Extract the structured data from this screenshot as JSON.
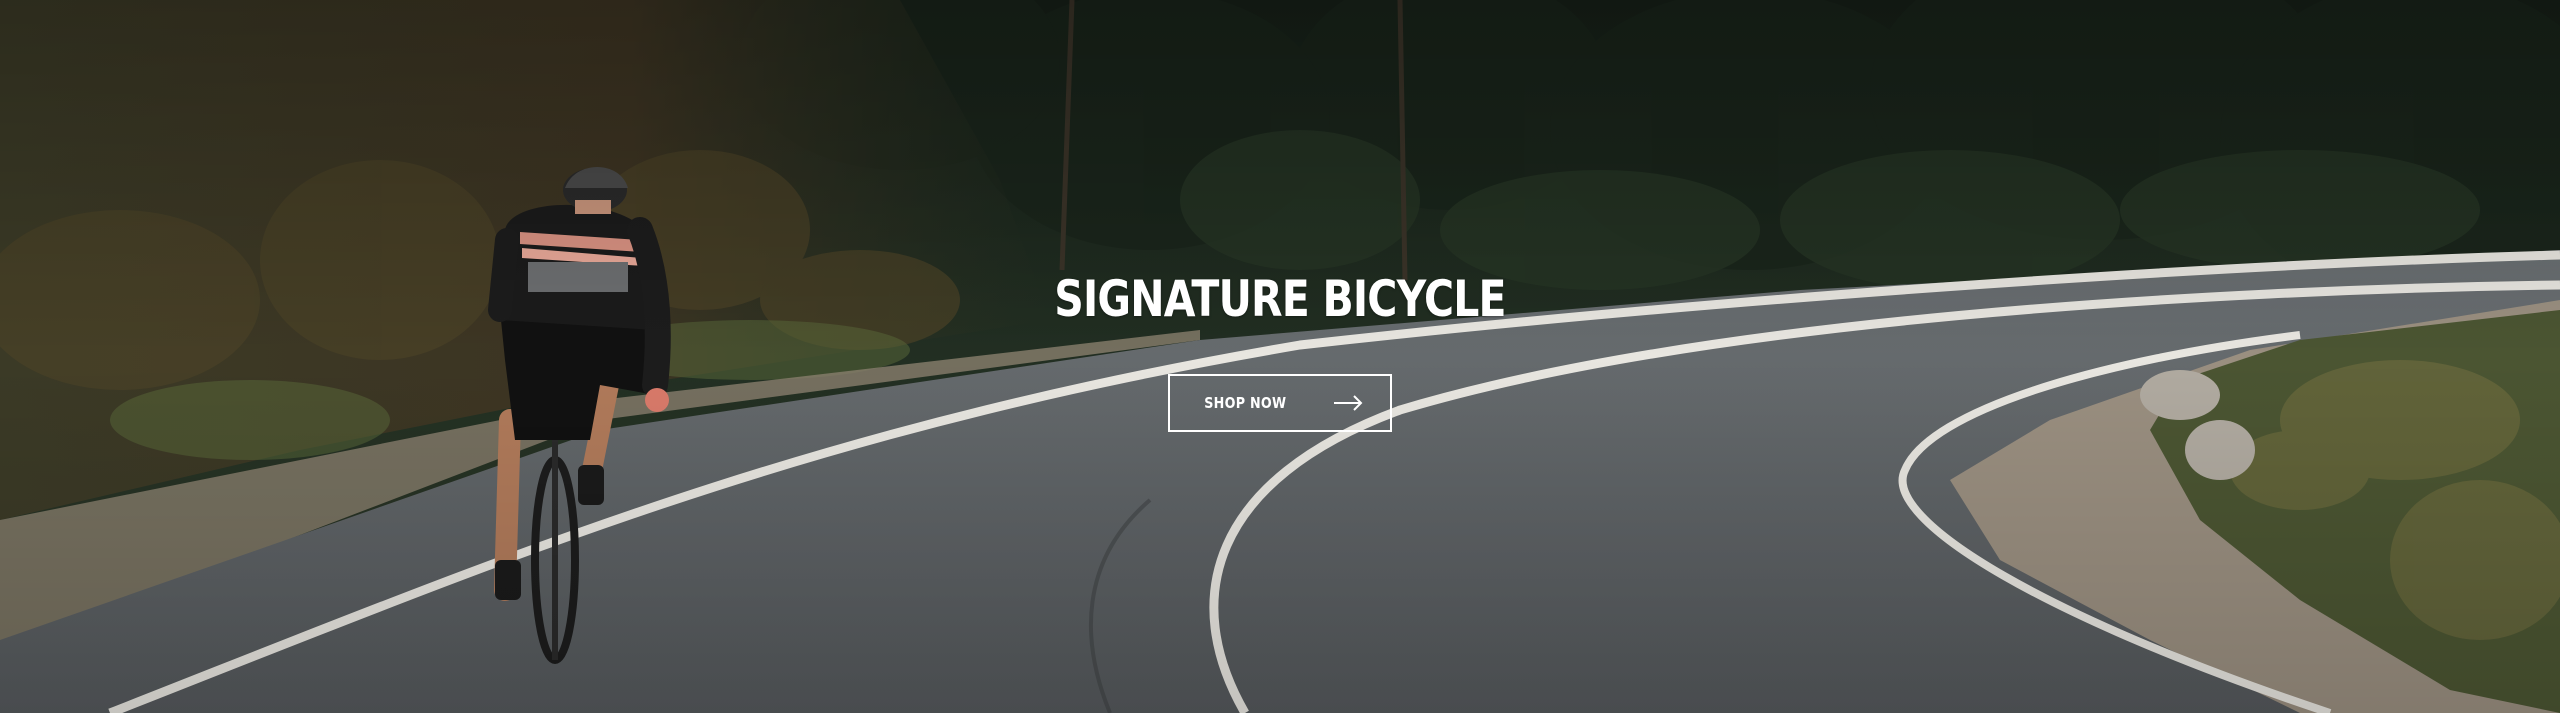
{
  "hero": {
    "title": "SIGNATURE BICYCLE",
    "button_label": "SHOP NOW",
    "button_icon": "arrow-right-icon",
    "image": "cyclist-riding-on-curved-forest-road"
  },
  "colors": {
    "text": "#ffffff",
    "road": "#5f6467",
    "forest": "#1f2b20",
    "road_line": "#e8e6e0"
  }
}
